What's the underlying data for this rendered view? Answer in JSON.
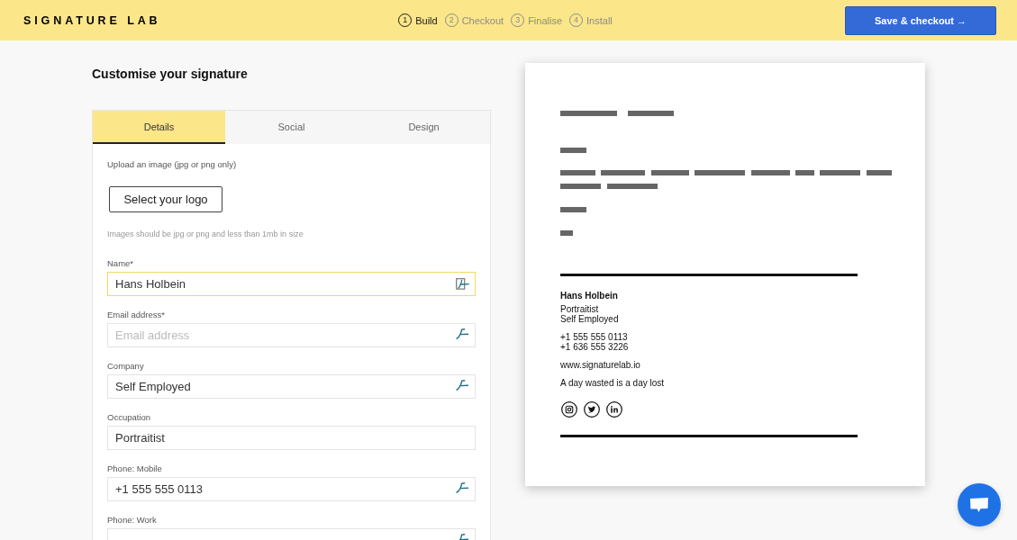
{
  "header": {
    "logo": "SIGNATURE LAB",
    "steps": [
      {
        "number": "1",
        "label": "Build",
        "selected": true
      },
      {
        "number": "2",
        "label": "Checkout",
        "selected": false
      },
      {
        "number": "3",
        "label": "Finalise",
        "selected": false
      },
      {
        "number": "4",
        "label": "Install",
        "selected": false
      }
    ],
    "save_button": "Save & checkout →"
  },
  "editor": {
    "title": "Customise your signature",
    "tabs": [
      {
        "label": "Details",
        "selected": true
      },
      {
        "label": "Social",
        "selected": false
      },
      {
        "label": "Design",
        "selected": false
      }
    ],
    "upload": {
      "label": "Upload an image (jpg or png only)",
      "button": "Select your logo",
      "hint": "Images should be jpg or png and less than 1mb in size"
    },
    "fields": [
      {
        "label": "Name*",
        "value": "Hans Holbein",
        "focused": true,
        "autofill_icon": true
      },
      {
        "label": "Email address*",
        "placeholder": "Email address",
        "focused": false,
        "autofill_icon": true
      },
      {
        "label": "Company",
        "value": "Self Employed",
        "focused": false,
        "autofill_icon": true
      },
      {
        "label": "Occupation",
        "value": "Portraitist",
        "focused": false,
        "autofill_icon": false
      },
      {
        "label": "Phone: Mobile",
        "value": "+1 555 555 0113",
        "focused": false,
        "autofill_icon": true
      },
      {
        "label": "Phone: Work",
        "focused": false,
        "autofill_icon": true
      }
    ]
  },
  "preview": {
    "signature": {
      "name": "Hans Holbein",
      "groups": [
        [
          "Portraitist",
          "Self Employed"
        ],
        [
          "+1 555 555 0113",
          "+1 636 555 3226"
        ],
        [
          "www.signaturelab.io"
        ],
        [
          "A day wasted is a day lost"
        ]
      ]
    }
  }
}
